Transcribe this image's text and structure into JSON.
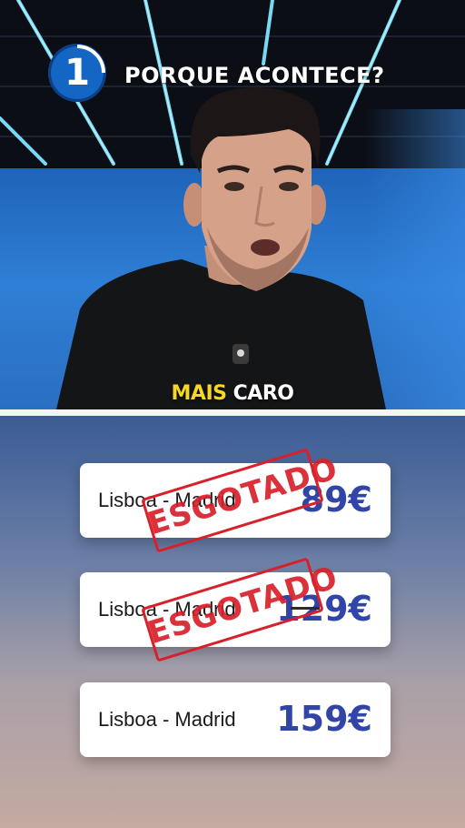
{
  "video": {
    "step_number": "1",
    "headline": "PORQUE ACONTECE?",
    "caption_highlight": "MAIS",
    "caption_rest": " CARO"
  },
  "tickets": [
    {
      "route": "Lisboa - Madrid",
      "price": "89€",
      "status": "ESGOTADO",
      "sold_out": true
    },
    {
      "route": "Lisboa - Madrid",
      "price": "129€",
      "status": "ESGOTADO",
      "sold_out": true
    },
    {
      "route": "Lisboa - Madrid",
      "price": "159€",
      "sold_out": false
    }
  ],
  "colors": {
    "price": "#3145a8",
    "stamp": "#d8202a",
    "caption_highlight": "#f5d726",
    "badge": "#1466c4"
  }
}
